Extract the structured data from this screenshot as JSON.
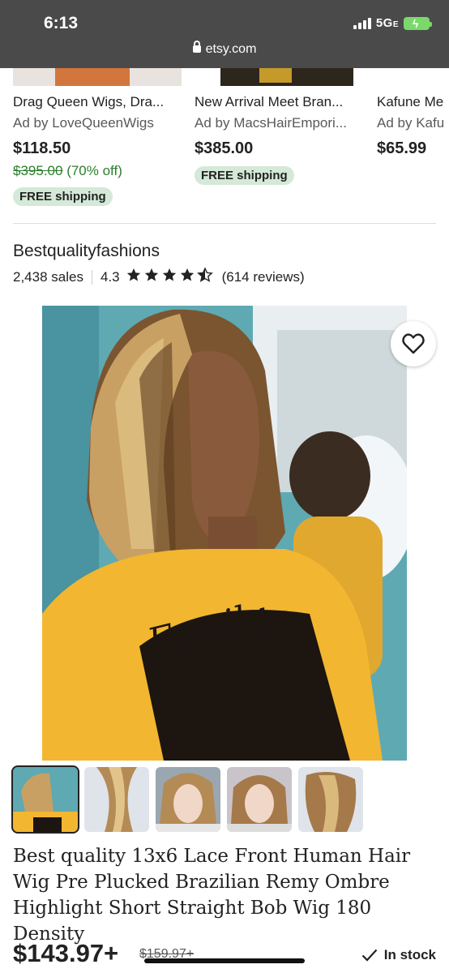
{
  "status_bar": {
    "time": "6:13",
    "network": "5G",
    "network_suffix": "E"
  },
  "browser": {
    "url": "etsy.com"
  },
  "ads": [
    {
      "title": "Drag Queen Wigs, Dra...",
      "ad_by": "Ad by LoveQueenWigs",
      "price": "$118.50",
      "original_price": "$395.00",
      "discount": "(70% off)",
      "badge": "FREE shipping"
    },
    {
      "title": "New Arrival Meet Bran...",
      "ad_by": "Ad by MacsHairEmpori...",
      "price": "$385.00",
      "badge": "FREE shipping"
    },
    {
      "title": "Kafune Me",
      "ad_by": "Ad by Kafu",
      "price": "$65.99"
    }
  ],
  "shop": {
    "name": "Bestqualityfashions",
    "sales": "2,438 sales",
    "rating": "4.3",
    "rating_stars": 4.5,
    "reviews": "(614 reviews)"
  },
  "product": {
    "title": "Best quality 13x6 Lace Front Human Hair Wig Pre Plucked Brazilian Remy Ombre Highlight Short Straight Bob Wig 180 Density",
    "price": "$143.97+",
    "original_price": "$159.97+",
    "stock": "In stock",
    "image_text": "Family"
  },
  "icons": {
    "heart": "heart-icon",
    "check": "checkmark-icon",
    "lock": "lock-icon",
    "star": "star-icon"
  },
  "colors": {
    "free_shipping_bg": "#d4e9d7",
    "discount_green": "#2d7d2d",
    "topbar": "#4a4a4a"
  }
}
